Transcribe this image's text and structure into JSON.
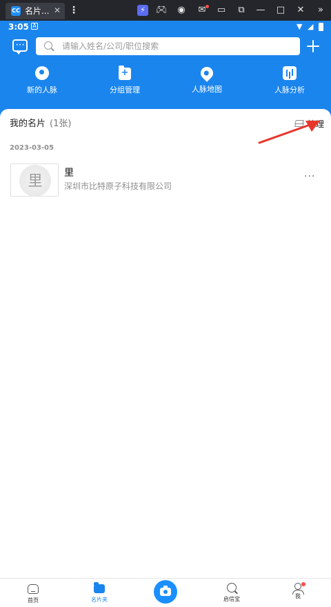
{
  "emulator": {
    "tab_title": "名片...",
    "tab_close": "✕",
    "more": "⋮",
    "icons": [
      "boost-icon",
      "gamepad-icon",
      "account-icon",
      "mail-icon",
      "minimize-icon",
      "popout-icon",
      "window-minimize-icon",
      "window-maximize-icon",
      "window-close-icon",
      "expand-icon"
    ],
    "app_icon_text": "CC"
  },
  "status_bar": {
    "time": "3:05",
    "a_label": "A"
  },
  "header": {
    "search_placeholder": "请输入姓名/公司/职位搜索",
    "quick_actions": [
      {
        "label": "新的人脉",
        "icon": "new-contacts-icon"
      },
      {
        "label": "分组管理",
        "icon": "group-manage-icon"
      },
      {
        "label": "人脉地图",
        "icon": "contacts-map-icon"
      },
      {
        "label": "人脉分析",
        "icon": "contacts-analysis-icon"
      }
    ],
    "accent_color": "#1b85ee"
  },
  "cards": {
    "title": "我的名片",
    "count": "(1张)",
    "manage_label": "管理",
    "date": "2023-03-05",
    "items": [
      {
        "avatar_char": "里",
        "name": "里",
        "company": "深圳市比特原子科技有限公司",
        "more": "···"
      }
    ]
  },
  "bottom_nav": {
    "items": [
      {
        "label": "首页",
        "icon": "home-icon"
      },
      {
        "label": "名片夹",
        "icon": "card-folder-icon",
        "active": true
      },
      {
        "label": "",
        "icon": "camera-icon"
      },
      {
        "label": "启信宝",
        "icon": "search-icon"
      },
      {
        "label": "我",
        "icon": "user-icon"
      }
    ]
  }
}
